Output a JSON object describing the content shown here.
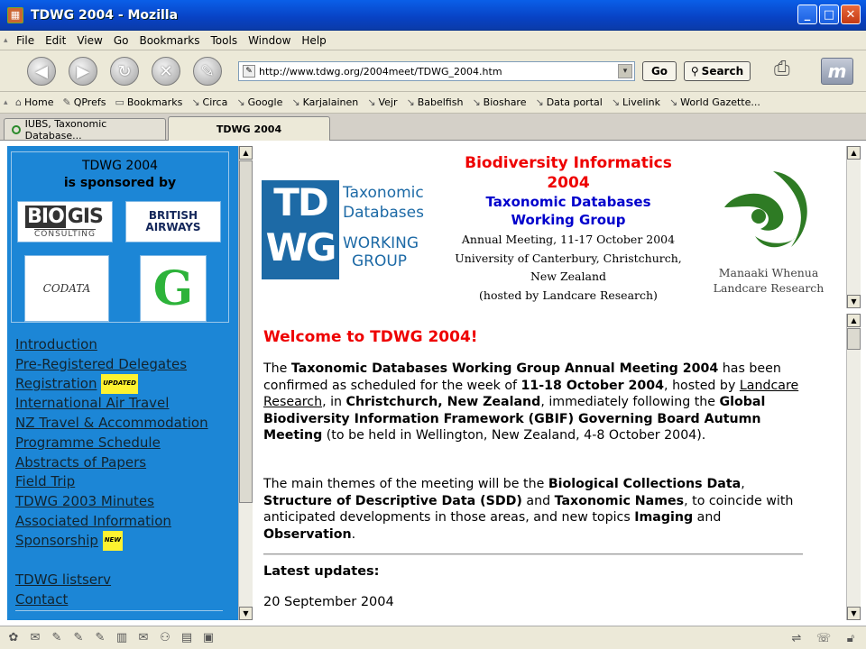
{
  "window": {
    "title": "TDWG 2004 - Mozilla",
    "min": "_",
    "max": "□",
    "close": "✕"
  },
  "menu": [
    "File",
    "Edit",
    "View",
    "Go",
    "Bookmarks",
    "Tools",
    "Window",
    "Help"
  ],
  "nav": {
    "url": "http://www.tdwg.org/2004meet/TDWG_2004.htm",
    "go_label": "Go",
    "search_label": "Search"
  },
  "bookmarks": [
    "Home",
    "QPrefs",
    "Bookmarks",
    "Circa",
    "Google",
    "Karjalainen",
    "Vejr",
    "Babelfish",
    "Bioshare",
    "Data portal",
    "Livelink",
    "World Gazette..."
  ],
  "tabs": [
    {
      "label": "IUBS, Taxonomic Database..."
    },
    {
      "label": "TDWG 2004"
    }
  ],
  "sidebar": {
    "sponsor_title": "TDWG 2004",
    "sponsor_sub": "is sponsored by",
    "sponsors": {
      "biogis_big_1": "BIO",
      "biogis_big_2": "GIS",
      "biogis_small": "CONSULTING",
      "ba_1": "BRITISH",
      "ba_2": "AIRWAYS",
      "codata": "CODATA",
      "gbif": "G"
    },
    "links": [
      {
        "label": "Introduction"
      },
      {
        "label": "Pre-Registered Delegates"
      },
      {
        "label": "Registration",
        "badge": "UPDATED"
      },
      {
        "label": "International Air Travel"
      },
      {
        "label": "NZ Travel & Accommodation"
      },
      {
        "label": "Programme Schedule"
      },
      {
        "label": "Abstracts of Papers"
      },
      {
        "label": "Field Trip"
      },
      {
        "label": "TDWG 2003 Minutes"
      },
      {
        "label": "Associated Information"
      },
      {
        "label": "Sponsorship",
        "badge": "NEW"
      }
    ],
    "links2": [
      {
        "label": "TDWG listserv"
      },
      {
        "label": "Contact"
      }
    ]
  },
  "header": {
    "logo_tdwg_1": "TD",
    "logo_tdwg_2": "WG",
    "logo_side_1": "Taxonomic",
    "logo_side_2": "Databases",
    "logo_side_3": "WORKING",
    "logo_side_4": "GROUP",
    "bi_title_1": "Biodiversity Informatics",
    "bi_title_2": "2004",
    "tdwg_full_1": "Taxonomic Databases",
    "tdwg_full_2": "Working Group",
    "detail_1": "Annual Meeting, 11-17 October 2004",
    "detail_2": "University of Canterbury, Christchurch,",
    "detail_3": "New Zealand",
    "detail_4": "(hosted by Landcare Research)",
    "landcare_1": "Manaaki Whenua",
    "landcare_2": "Landcare Research"
  },
  "main": {
    "welcome": "Welcome to TDWG 2004!",
    "p1": {
      "t1": "The ",
      "b1": "Taxonomic Databases Working Group Annual Meeting 2004",
      "t2": " has been confirmed as scheduled for the week of ",
      "b2": "11-18 October 2004",
      "t3": ", hosted by ",
      "link": "Landcare Research",
      "t4": ", in ",
      "b3": "Christchurch, New Zealand",
      "t5": ", immediately following the ",
      "b4": "Global Biodiversity Information Framework (GBIF) Governing Board Autumn Meeting",
      "t6": " (to be held in Wellington, New Zealand, 4-8 October 2004)."
    },
    "p2": {
      "t1": "The main themes of the meeting will be the ",
      "b1": "Biological Collections Data",
      "t2": ", ",
      "b2": "Structure of Descriptive Data (SDD)",
      "t3": " and ",
      "b3": "Taxonomic Names",
      "t4": ", to coincide with anticipated developments in those areas, and new topics ",
      "b4": "Imaging",
      "t5": " and ",
      "b5": "Observation",
      "t6": "."
    },
    "latest": "Latest updates:",
    "date": "20 September 2004"
  }
}
